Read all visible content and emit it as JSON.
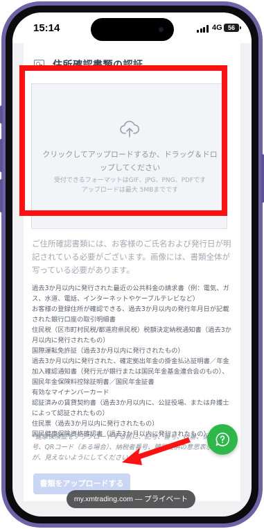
{
  "status_bar": {
    "time": "15:14",
    "network": "4G",
    "battery": "56"
  },
  "page": {
    "title": "住所確認書類の認証",
    "title_icon": "id-card-icon"
  },
  "dropzone": {
    "icon": "cloud-upload-icon",
    "main_text": "クリックしてアップロードするか、ドラッグ＆ドロップしてください",
    "formats_text": "受付できるフォーマットはGIF、JPG、PNG、PDFです",
    "size_text": "アップロードは最大 5MBまでです"
  },
  "notice": "ご住所確認書類には、お客様のご氏名および発行日が明記されている必要がございます。画像には、書類全体が写っている必要があります。",
  "accepted_documents": [
    "過去3か月以内に発行された最近の公共料金の請求書（例：電気、ガス、水道、電話、インターネットやケーブルテレビなど）",
    "お客様の登録住所が確認できる、過去3か月以内の発行年月日が記載された銀行口座の取引明細書",
    "住民税（区市町村民税/都道府県民税）税額決定納税通知書（過去3か月以内に発行されたもの）",
    "国際運転免許証（過去3か月以内に発行されたもの）",
    "過去3か月以内に発行された、確定拠出年金の掛金払込証明書／年金加入確認通知書（発行元が銀行または国民年金基金連合会のもの）、国民年金保険料控除証明書／国民年金証書",
    "有効なマイナンバーカード",
    "認証済みの賃貸契約書（過去3か月以内に、公証役場、または弁護士によって認証されたもの）",
    "住民票（過去3か月以内に発行されたもの）",
    "国民健康保険資格確認書（過去3か月以内に発行されたもの）"
  ],
  "note": "*健康保険証をアップロードする前に、記号、番号、枝番、保険者番号、QRコード（ある場合）、納税者番号、臓器提供の意思表示などが、見えないようにしてください。",
  "submit_button": "書類をアップロードする",
  "chat_button_icon": "chat-help-icon",
  "browser": {
    "url_text": "my.xmtrading.com — プライベート"
  },
  "colors": {
    "highlight": "#ff1111",
    "arrow": "#ff1111",
    "chat": "#2eb84a",
    "button_disabled": "#c9d7f4",
    "frame": "#6f63a8"
  }
}
